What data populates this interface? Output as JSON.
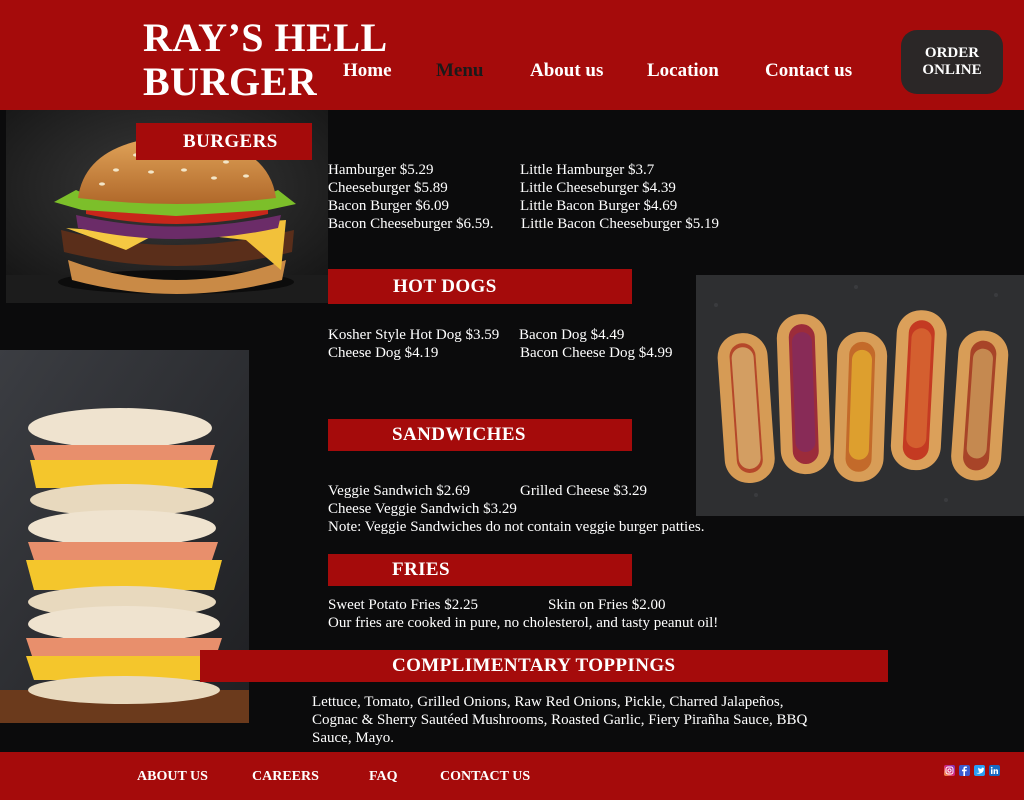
{
  "header": {
    "brand_line1": "RAY’S HELL",
    "brand_line2": "BURGER",
    "nav": [
      {
        "label": "Home",
        "active": false
      },
      {
        "label": "Menu",
        "active": true
      },
      {
        "label": "About us",
        "active": false
      },
      {
        "label": "Location",
        "active": false
      },
      {
        "label": "Contact us",
        "active": false
      }
    ],
    "order_line1": "ORDER",
    "order_line2": "ONLINE"
  },
  "sections": {
    "burgers": {
      "title": "BURGERS",
      "left": [
        "Hamburger $5.29",
        "Cheeseburger $5.89",
        "Bacon Burger $6.09",
        "Bacon Cheeseburger $6.59."
      ],
      "right": [
        "Little Hamburger $3.7",
        "Little Cheeseburger $4.39",
        "Little Bacon Burger $4.69",
        "Little Bacon Cheeseburger $5.19"
      ]
    },
    "hotdogs": {
      "title": "HOT DOGS",
      "left": [
        "Kosher Style Hot Dog $3.59",
        "Cheese Dog $4.19"
      ],
      "right": [
        "Bacon Dog $4.49",
        "Bacon Cheese Dog $4.99"
      ]
    },
    "sandwiches": {
      "title": "SANDWICHES",
      "left": [
        "Veggie Sandwich $2.69",
        "Cheese Veggie Sandwich $3.29"
      ],
      "right": [
        "Grilled Cheese $3.29"
      ],
      "note": "Note: Veggie Sandwiches do not contain veggie burger patties."
    },
    "fries": {
      "title": "FRIES",
      "left": [
        "Sweet Potato Fries $2.25"
      ],
      "right": [
        "Skin on Fries $2.00"
      ],
      "note": "Our fries are cooked in pure, no cholesterol, and tasty peanut oil!"
    },
    "toppings": {
      "title": "COMPLIMENTARY TOPPINGS",
      "lines": [
        "Lettuce, Tomato, Grilled Onions, Raw Red Onions, Pickle, Charred Jalapeños,",
        "Cognac & Sherry Sautéed Mushrooms, Roasted Garlic, Fiery Pirañha Sauce, BBQ",
        "Sauce, Mayo."
      ]
    }
  },
  "footer": {
    "links": [
      "ABOUT US",
      "CAREERS",
      "FAQ",
      "CONTACT US"
    ],
    "social_icons": [
      "instagram-icon",
      "facebook-icon",
      "twitter-icon",
      "linkedin-icon"
    ]
  },
  "colors": {
    "brand_red": "#a50b0b",
    "background": "#0b0b0c",
    "order_button": "#2b2727"
  }
}
